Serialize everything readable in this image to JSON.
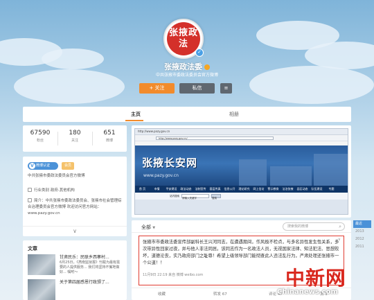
{
  "profile": {
    "avatar_text": "张掖政法",
    "name": "张掖政法委",
    "intro": "中共张掖市委政法委员会官方微博",
    "follow_label": "+ 关注",
    "message_label": "私信",
    "more_label": "≡"
  },
  "tabs": [
    {
      "label": "主页"
    },
    {
      "label": "相册"
    }
  ],
  "stats": [
    {
      "value": "67590",
      "label": "粉丝"
    },
    {
      "value": "180",
      "label": "关注"
    },
    {
      "value": "651",
      "label": "微博"
    }
  ],
  "info": {
    "badge": "微博认证",
    "vip": "会员",
    "verify_text": "中共张掖市委政法委员会官方微博",
    "industry": "行业类别  政府-其他机构",
    "desc": "简介：中共张掖市委政法委员会、张掖市社会管理综合治理委员会官方微博 欢迎访问官方网站：www.pazy.gov.cn",
    "more": "∨"
  },
  "articles": {
    "title": "文章",
    "items": [
      {
        "title": "甘肃民乐：民联乡西寨村...",
        "snippet": "6月25日，《肃南监狱报》刊载为最有需要的人提供服务... 我们将坚持不懈地做好... 嘱咐～"
      },
      {
        "title": "关于第四届感恩行政颁了..."
      }
    ]
  },
  "browser": {
    "title": "http://www.pazy.gov.cn",
    "url": "http://www.pazy.gov.cn/",
    "site_title": "张掖长安网",
    "site_url": "www.pazy.gov.cn",
    "nav": [
      "首 页",
      "市情",
      "平安建设",
      "政法动态",
      "法制宣传",
      "基层传真",
      "信息公开",
      "理论研究",
      "网上信访",
      "警示教育",
      "法治张掖",
      "县区动态",
      "队伍建设",
      "专题"
    ],
    "search_label": "站内搜索",
    "search_value": "请输入关键字",
    "search_btn": "搜索"
  },
  "feed": {
    "filter": "全部",
    "search_placeholder": "搜索我的微博",
    "post_text": "张掖市市委政法委宣传部副科长王兴河同志，在遭遇期间，作风极不检点，与多名异性发生性关系，多次带异性回家过夜，并与他人非法同居。该同志作为一名政法人员，无视国家法律、知法犯法、思想败坏，道德沦丧，实乃政府部门之耻辱！希望上级领导部门能彻查此人违法乱行为，严肃处理还张掖市一个公道！！",
    "post_meta": "11月9日 22:19 来自 微博 weibo.com",
    "actions": [
      "收藏",
      "转发 67",
      "评论 47",
      "赞 1"
    ]
  },
  "years": [
    "最近",
    "2013",
    "2012",
    "2011"
  ],
  "watermark": {
    "cn": "中新网",
    "en": "Chinanews.com"
  },
  "colors": {
    "accent": "#f28b2c",
    "brand_red": "#d4302a",
    "highlight_red": "#e03b30",
    "sky": "#a9cde6",
    "link_blue": "#4b92d8"
  }
}
